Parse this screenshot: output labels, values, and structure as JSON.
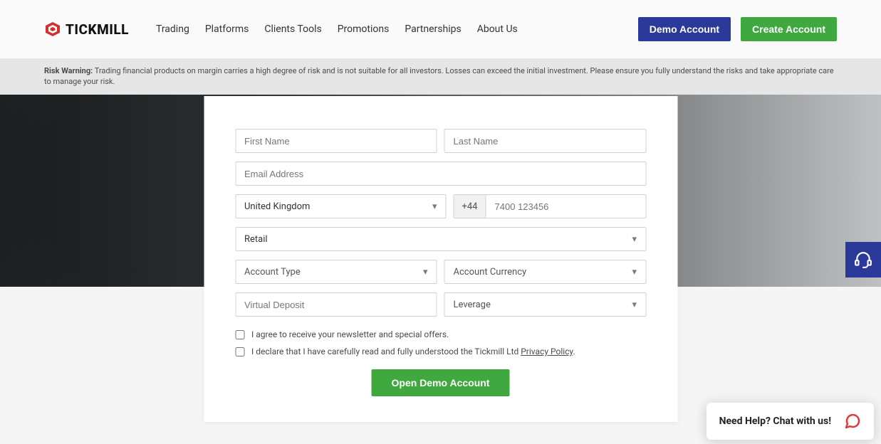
{
  "brand": "TICKMILL",
  "nav": [
    "Trading",
    "Platforms",
    "Clients Tools",
    "Promotions",
    "Partnerships",
    "About Us"
  ],
  "actions": {
    "demo": "Demo Account",
    "create": "Create Account"
  },
  "risk": {
    "label": "Risk Warning:",
    "text": " Trading financial products on margin carries a high degree of risk and is not suitable for all investors. Losses can exceed the initial investment. Please ensure you fully understand the risks and take appropriate care to manage your risk."
  },
  "form": {
    "first_name_ph": "First Name",
    "last_name_ph": "Last Name",
    "email_ph": "Email Address",
    "country": "United Kingdom",
    "dial_code": "+44",
    "phone_ph": "7400 123456",
    "client_type": "Retail",
    "account_type_ph": "Account Type",
    "currency_ph": "Account Currency",
    "deposit_ph": "Virtual Deposit",
    "leverage_ph": "Leverage",
    "check_news": "I agree to receive your newsletter and special offers.",
    "check_privacy_pre": "I declare that I have carefully read and fully understood the Tickmill Ltd ",
    "check_privacy_link": "Privacy Policy",
    "check_privacy_post": ".",
    "submit": "Open Demo Account"
  },
  "chat": "Need Help? Chat with us!"
}
